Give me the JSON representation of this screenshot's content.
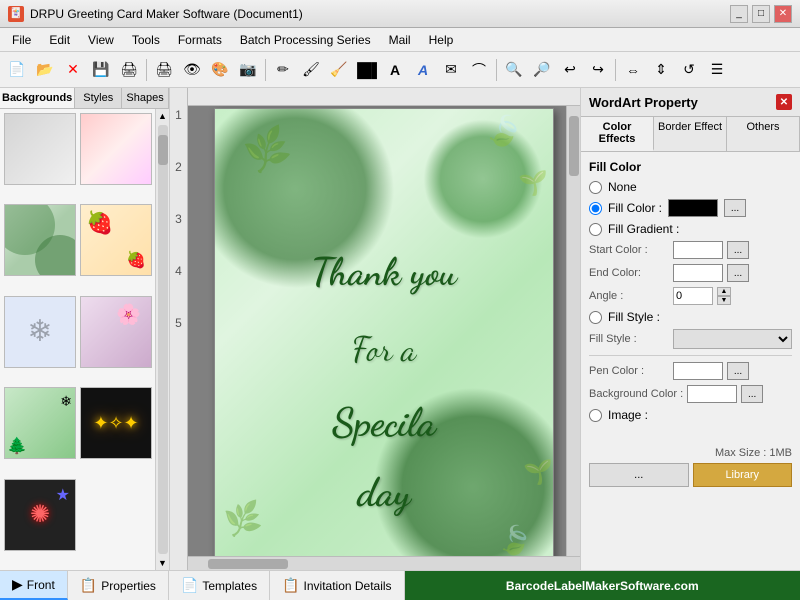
{
  "titlebar": {
    "title": "DRPU Greeting Card Maker Software (Document1)",
    "controls": [
      "_",
      "□",
      "✕"
    ]
  },
  "menubar": {
    "items": [
      "File",
      "Edit",
      "View",
      "Tools",
      "Formats",
      "Batch Processing Series",
      "Mail",
      "Help"
    ]
  },
  "left_panel": {
    "tabs": [
      "Backgrounds",
      "Styles",
      "Shapes"
    ],
    "active_tab": "Backgrounds"
  },
  "card": {
    "lines": [
      "Thank you",
      "For a",
      "Specila",
      "day"
    ]
  },
  "right_panel": {
    "title": "WordArt Property",
    "close_label": "✕",
    "tabs": [
      "Color Effects",
      "Border Effect",
      "Others"
    ],
    "active_tab": "Color Effects",
    "fill_color_section": "Fill Color",
    "radio_none": "None",
    "radio_fill_color": "Fill Color :",
    "radio_fill_gradient": "Fill Gradient :",
    "start_color_label": "Start Color :",
    "end_color_label": "End Color:",
    "angle_label": "Angle :",
    "angle_value": "0",
    "radio_fill_style": "Fill Style :",
    "fill_style_label": "Fill Style :",
    "pen_color_label": "Pen Color :",
    "bg_color_label": "Background Color :",
    "radio_image": "Image :",
    "max_size": "Max Size : 1MB",
    "btn_dots": "...",
    "btn_library": "Library"
  },
  "statusbar": {
    "tabs": [
      {
        "label": "Front",
        "icon": "▶"
      },
      {
        "label": "Properties",
        "icon": "📋"
      },
      {
        "label": "Templates",
        "icon": "📄"
      },
      {
        "label": "Invitation Details",
        "icon": "📋"
      }
    ],
    "brand": "BarcodeLabelMakerSoftware.com"
  },
  "thumbs": [
    {
      "class": "thumb-bg1",
      "text": ""
    },
    {
      "class": "thumb-bg2",
      "text": ""
    },
    {
      "class": "thumb-bg3",
      "text": ""
    },
    {
      "class": "thumb-bg4",
      "text": ""
    },
    {
      "class": "thumb-bg5",
      "text": ""
    },
    {
      "class": "thumb-bg6",
      "text": ""
    },
    {
      "class": "thumb-bg7",
      "text": ""
    },
    {
      "class": "thumb-sparkle",
      "text": "✦"
    },
    {
      "class": "thumb-bg3",
      "text": ""
    }
  ]
}
